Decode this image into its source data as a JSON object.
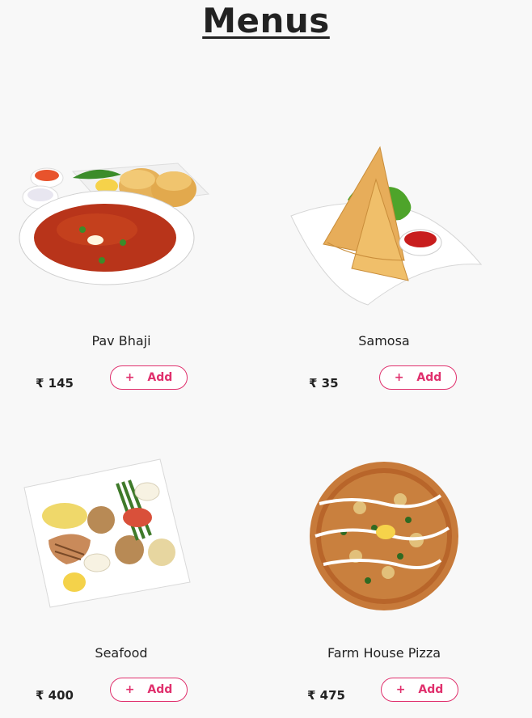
{
  "page": {
    "title": "Menus"
  },
  "currency_symbol": "₹",
  "menu_items": [
    {
      "name": "Pav Bhaji",
      "price": "₹ 145",
      "add_label": "Add",
      "plus": "+"
    },
    {
      "name": "Samosa",
      "price": "₹ 35",
      "add_label": "Add",
      "plus": "+"
    },
    {
      "name": "Seafood",
      "price": "₹ 400",
      "add_label": "Add",
      "plus": "+"
    },
    {
      "name": "Farm House Pizza",
      "price": "₹ 475",
      "add_label": "Add",
      "plus": "+"
    }
  ],
  "colors": {
    "accent": "#e0306d",
    "background": "#f8f8f8",
    "text": "#222222"
  }
}
